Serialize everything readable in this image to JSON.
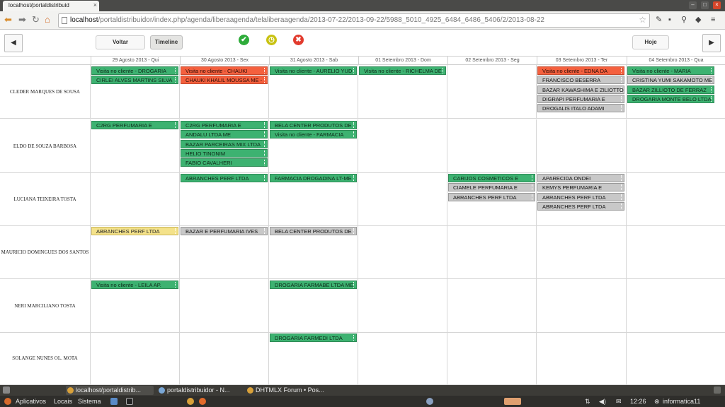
{
  "browser": {
    "tab_title": "localhost/portaldistribuid",
    "url_host": "localhost",
    "url_path": "/portaldistribuidor/index.php/agenda/liberaagenda/telaliberaagenda/2013-07-22/2013-09-22/5988_5010_4925_6484_6486_5406/2/2013-08-22"
  },
  "header": {
    "voltar_label": "Voltar",
    "timeline_label": "Timeline",
    "hoje_label": "Hoje",
    "prev_label": "◀",
    "next_label": "▶",
    "status_icons": [
      {
        "name": "approve-icon",
        "color": "#2eac3a",
        "glyph": "✔"
      },
      {
        "name": "pending-clock-icon",
        "color": "#c8c212",
        "glyph": "◷"
      },
      {
        "name": "reject-icon",
        "color": "#e23b2e",
        "glyph": "✖"
      }
    ]
  },
  "dates": [
    "29 Agosto 2013 - Qui",
    "30 Agosto 2013 - Sex",
    "31 Agosto 2013 - Sab",
    "01 Setembro 2013 - Dom",
    "02 Setembro 2013 - Seg",
    "03 Setembro 2013 - Ter",
    "04 Setembro 2013 - Qua"
  ],
  "rows": [
    {
      "name": "CLEDER MARQUES DE SOUSA",
      "days": [
        [
          {
            "t": "Visita no cliente - DROGARIA",
            "c": "green"
          },
          {
            "t": "CIRLEI ALVES MARTINS SILVA",
            "c": "green"
          }
        ],
        [
          {
            "t": "Visita no cliente - CHAUKI",
            "c": "red"
          },
          {
            "t": "CHAUKI KHALIL MOUSSA ME -",
            "c": "red"
          }
        ],
        [
          {
            "t": "Visita no cliente - AURELIO YUD",
            "c": "green"
          }
        ],
        [
          {
            "t": "Visita no cliente - RICHELMA DE",
            "c": "green"
          }
        ],
        [],
        [
          {
            "t": "Visita no cliente - EDNA DA",
            "c": "red"
          },
          {
            "t": "FRANCISCO BESERRA",
            "c": "gray"
          },
          {
            "t": "BAZAR KAWASHIMA E ZILIOTTO",
            "c": "gray"
          },
          {
            "t": "DIGRAPI PERFUMARIA E",
            "c": "gray"
          },
          {
            "t": "DROGALIS ITALO ADAMI",
            "c": "gray"
          }
        ],
        [
          {
            "t": "Visita no cliente - MARIA",
            "c": "green"
          },
          {
            "t": "CRISTINA YUMI SAKAMOTO ME",
            "c": "gray"
          },
          {
            "t": "BAZAR ZILLIOTO DE FERRAZ",
            "c": "green"
          },
          {
            "t": "DROGARIA MONTE BELO LTDA",
            "c": "green"
          }
        ]
      ]
    },
    {
      "name": "ELDO DE SOUZA BARBOSA",
      "days": [
        [
          {
            "t": "C2RG PERFUMARIA E",
            "c": "green"
          }
        ],
        [
          {
            "t": "C2RG PERFUMARIA E",
            "c": "green"
          },
          {
            "t": "ANDALU LTDA ME",
            "c": "green"
          },
          {
            "t": "BAZAR PARCEIRAS MIX LTDA",
            "c": "green"
          },
          {
            "t": "HELIO TINONIM",
            "c": "green"
          },
          {
            "t": "FABIO CAVALHERI",
            "c": "green"
          }
        ],
        [
          {
            "t": "BELA CENTER PRODUTOS DE",
            "c": "green"
          },
          {
            "t": "Visita no cliente - FARMACIA",
            "c": "green"
          }
        ],
        [],
        [],
        [],
        []
      ]
    },
    {
      "name": "LUCIANA TEIXEIRA TOSTA",
      "days": [
        [],
        [
          {
            "t": "ABRANCHES PERF LTDA",
            "c": "green"
          }
        ],
        [
          {
            "t": "FARMACIA DROGADINA LT-ME",
            "c": "green"
          }
        ],
        [],
        [
          {
            "t": "CARIJOS COSMETICOS E",
            "c": "green"
          },
          {
            "t": "CIAMELE PERFUMARIA E",
            "c": "gray"
          },
          {
            "t": "ABRANCHES PERF LTDA",
            "c": "gray"
          }
        ],
        [
          {
            "t": "APARECIDA ONDEI",
            "c": "gray"
          },
          {
            "t": "KEMYS PERFUMARIA E",
            "c": "gray"
          },
          {
            "t": "ABRANCHES PERF LTDA",
            "c": "gray"
          },
          {
            "t": "ABRANCHES PERF LTDA",
            "c": "gray"
          }
        ],
        []
      ]
    },
    {
      "name": "MAURICIO DOMINGUES DOS SANTOS",
      "days": [
        [
          {
            "t": "ABRANCHES PERF LTDA",
            "c": "yellow"
          }
        ],
        [
          {
            "t": "BAZAR E PERFUMARIA IVES",
            "c": "gray"
          }
        ],
        [
          {
            "t": "BELA CENTER PRODUTOS DE",
            "c": "gray"
          }
        ],
        [],
        [],
        [],
        []
      ]
    },
    {
      "name": "NERI MARCILIANO TOSTA",
      "days": [
        [
          {
            "t": "Visita no cliente - LEILA AP.",
            "c": "green"
          }
        ],
        [],
        [
          {
            "t": "DROGARIA FARMABE LTDA ME",
            "c": "green"
          }
        ],
        [],
        [],
        [],
        []
      ]
    },
    {
      "name": "SOLANGE NUNES OL. MOTA",
      "days": [
        [],
        [],
        [
          {
            "t": "DROGARIA FARMEDI LTDA",
            "c": "green"
          }
        ],
        [],
        [],
        [],
        []
      ]
    }
  ],
  "taskbar": {
    "tasks": [
      "localhost/portaldistrib...",
      "portaldistribuidor - N...",
      "DHTMLX Forum • Pos..."
    ],
    "menus": [
      "Aplicativos",
      "Locais",
      "Sistema"
    ],
    "clock": "12:26",
    "user": "informatica11"
  }
}
